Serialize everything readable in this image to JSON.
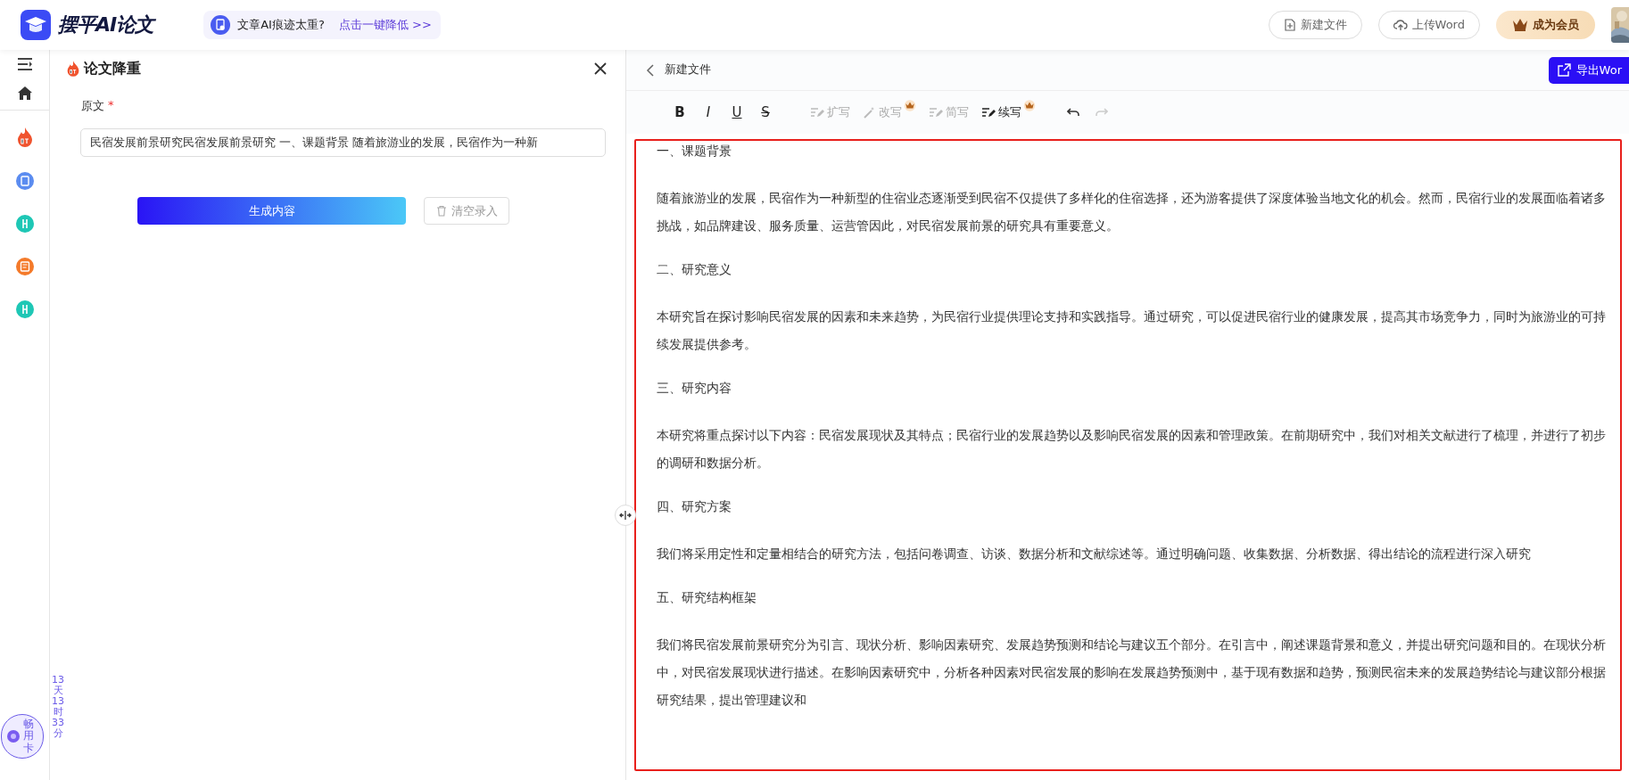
{
  "header": {
    "logo_text": "摆平AI论文",
    "promo": {
      "text": "文章AI痕迹太重?",
      "link": "点击一键降低 >>"
    },
    "buttons": [
      {
        "kind": "new-file",
        "label": "新建文件"
      },
      {
        "kind": "upload",
        "label": "上传Word"
      },
      {
        "kind": "vip",
        "label": "成为会员"
      }
    ]
  },
  "rail": {
    "card": {
      "label": "畅用卡",
      "countdown": "13天13时33分"
    }
  },
  "panel": {
    "title": "论文降重",
    "field": {
      "label": "原文",
      "required_mark": "*",
      "value": "民宿发展前景研究民宿发展前景研究  一、课题背景  随着旅游业的发展，民宿作为一种新"
    },
    "buttons": [
      {
        "kind": "primary",
        "label": "生成内容"
      },
      {
        "kind": "clear",
        "label": "清空录入"
      }
    ]
  },
  "editor": {
    "file_name": "新建文件",
    "export": "导出Wor",
    "toolbar": [
      {
        "kind": "bold",
        "label": "B"
      },
      {
        "kind": "italic",
        "label": "I"
      },
      {
        "kind": "underline",
        "label": "U"
      },
      {
        "kind": "strike",
        "label": "S"
      },
      {
        "kind": "expand",
        "label": "扩写",
        "disabled": true,
        "premium": false
      },
      {
        "kind": "rewrite",
        "label": "改写",
        "disabled": true,
        "premium": true
      },
      {
        "kind": "shorten",
        "label": "简写",
        "disabled": true,
        "premium": false
      },
      {
        "kind": "continue",
        "label": "续写",
        "disabled": false,
        "premium": true
      },
      {
        "kind": "undo",
        "disabled": false
      },
      {
        "kind": "redo",
        "disabled": true
      }
    ],
    "content": [
      {
        "kind": "heading",
        "text": "一、课题背景"
      },
      {
        "kind": "paragraph",
        "text": "随着旅游业的发展，民宿作为一种新型的住宿业态逐渐受到民宿不仅提供了多样化的住宿选择，还为游客提供了深度体验当地文化的机会。然而，民宿行业的发展面临着诸多挑战，如品牌建设、服务质量、运营管因此，对民宿发展前景的研究具有重要意义。"
      },
      {
        "kind": "heading",
        "text": "二、研究意义"
      },
      {
        "kind": "paragraph",
        "text": "本研究旨在探讨影响民宿发展的因素和未来趋势，为民宿行业提供理论支持和实践指导。通过研究，可以促进民宿行业的健康发展，提高其市场竞争力，同时为旅游业的可持续发展提供参考。"
      },
      {
        "kind": "heading",
        "text": "三、研究内容"
      },
      {
        "kind": "paragraph",
        "text": "本研究将重点探讨以下内容：民宿发展现状及其特点；民宿行业的发展趋势以及影响民宿发展的因素和管理政策。在前期研究中，我们对相关文献进行了梳理，并进行了初步的调研和数据分析。"
      },
      {
        "kind": "heading",
        "text": "四、研究方案"
      },
      {
        "kind": "paragraph",
        "text": "我们将采用定性和定量相结合的研究方法，包括问卷调查、访谈、数据分析和文献综述等。通过明确问题、收集数据、分析数据、得出结论的流程进行深入研究"
      },
      {
        "kind": "heading",
        "text": "五、研究结构框架"
      },
      {
        "kind": "paragraph",
        "text": "我们将民宿发展前景研究分为引言、现状分析、影响因素研究、发展趋势预测和结论与建议五个部分。在引言中，阐述课题背景和意义，并提出研究问题和目的。在现状分析中，对民宿发展现状进行描述。在影响因素研究中，分析各种因素对民宿发展的影响在发展趋势预测中，基于现有数据和趋势，预测民宿未来的发展趋势结论与建议部分根据研究结果，提出管理建议和"
      }
    ]
  }
}
